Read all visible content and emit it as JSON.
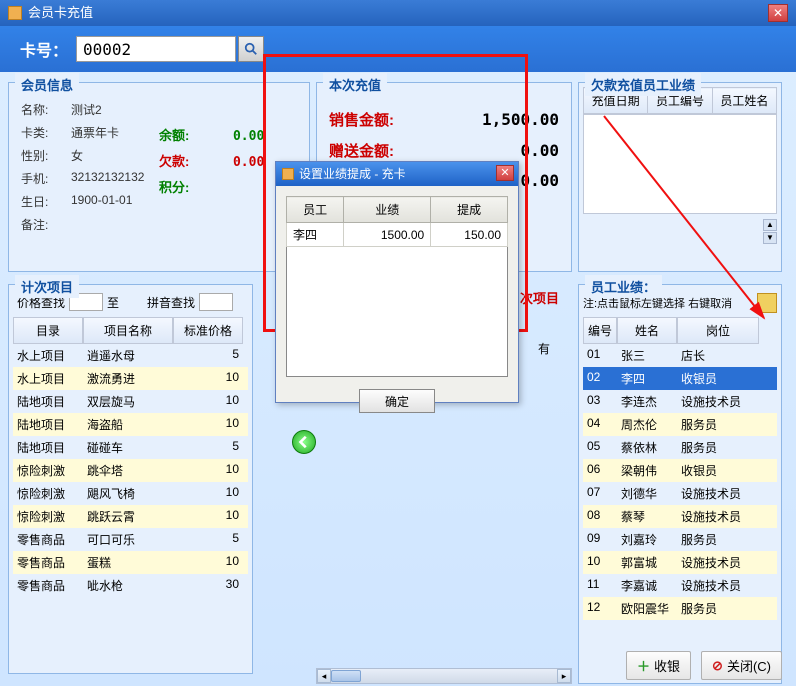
{
  "window": {
    "title": "会员卡充值"
  },
  "topbar": {
    "label": "卡号：",
    "value": "00002"
  },
  "member": {
    "title": "会员信息",
    "fields": {
      "name_k": "名称:",
      "name_v": "测试2",
      "type_k": "卡类:",
      "type_v": "通票年卡",
      "sex_k": "性别:",
      "sex_v": "女",
      "phone_k": "手机:",
      "phone_v": "32132132132",
      "birth_k": "生日:",
      "birth_v": "1900-01-01",
      "note_k": "备注:",
      "note_v": ""
    },
    "extra": {
      "balance_k": "余额:",
      "balance_v": "0.00",
      "arrears_k": "欠款:",
      "arrears_v": "0.00",
      "points_k": "积分:",
      "points_v": ""
    }
  },
  "recharge": {
    "title": "本次充值",
    "sale_k": "销售金额:",
    "sale_v": "1,500.00",
    "bonus_k": "赠送金额:",
    "bonus_v": "0.00",
    "line3_v": "0.00"
  },
  "arrears_panel": {
    "title": "欠款充值员工业绩",
    "cols": {
      "c1": "充值日期",
      "c2": "员工编号",
      "c3": "员工姓名"
    }
  },
  "items": {
    "title": "计次项目",
    "search": {
      "price_k": "价格查找",
      "to": "至",
      "py_k": "拼音查找"
    },
    "cols": {
      "c1": "目录",
      "c2": "项目名称",
      "c3": "标准价格"
    },
    "rows": [
      {
        "c1": "水上项目",
        "c2": "逍遥水母",
        "c3": "5"
      },
      {
        "c1": "水上项目",
        "c2": "激流勇进",
        "c3": "10"
      },
      {
        "c1": "陆地项目",
        "c2": "双层旋马",
        "c3": "10"
      },
      {
        "c1": "陆地项目",
        "c2": "海盗船",
        "c3": "10"
      },
      {
        "c1": "陆地项目",
        "c2": "碰碰车",
        "c3": "5"
      },
      {
        "c1": "惊险刺激",
        "c2": "跳伞塔",
        "c3": "10"
      },
      {
        "c1": "惊险刺激",
        "c2": "飓风飞椅",
        "c3": "10"
      },
      {
        "c1": "惊险刺激",
        "c2": "跳跃云霄",
        "c3": "10"
      },
      {
        "c1": "零售商品",
        "c2": "可口可乐",
        "c3": "5"
      },
      {
        "c1": "零售商品",
        "c2": "蛋糕",
        "c3": "10"
      },
      {
        "c1": "零售商品",
        "c2": "呲水枪",
        "c3": "30"
      }
    ]
  },
  "mid": {
    "has_items": "次项目",
    "has_col": "有"
  },
  "emp": {
    "title": "员工业绩：",
    "note": "注:点击鼠标左键选择 右键取消",
    "cols": {
      "c1": "编号",
      "c2": "姓名",
      "c3": "岗位"
    },
    "rows": [
      {
        "c1": "01",
        "c2": "张三",
        "c3": "店长",
        "sel": false
      },
      {
        "c1": "02",
        "c2": "李四",
        "c3": "收银员",
        "sel": true
      },
      {
        "c1": "03",
        "c2": "李连杰",
        "c3": "设施技术员",
        "sel": false
      },
      {
        "c1": "04",
        "c2": "周杰伦",
        "c3": "服务员",
        "sel": false
      },
      {
        "c1": "05",
        "c2": "蔡依林",
        "c3": "服务员",
        "sel": false
      },
      {
        "c1": "06",
        "c2": "梁朝伟",
        "c3": "收银员",
        "sel": false
      },
      {
        "c1": "07",
        "c2": "刘德华",
        "c3": "设施技术员",
        "sel": false
      },
      {
        "c1": "08",
        "c2": "蔡琴",
        "c3": "设施技术员",
        "sel": false
      },
      {
        "c1": "09",
        "c2": "刘嘉玲",
        "c3": "服务员",
        "sel": false
      },
      {
        "c1": "10",
        "c2": "郭富城",
        "c3": "设施技术员",
        "sel": false
      },
      {
        "c1": "11",
        "c2": "李嘉诚",
        "c3": "设施技术员",
        "sel": false
      },
      {
        "c1": "12",
        "c2": "欧阳震华",
        "c3": "服务员",
        "sel": false
      }
    ]
  },
  "footer": {
    "cashier": "收银",
    "close": "关闭(C)"
  },
  "modal": {
    "title": "设置业绩提成 - 充卡",
    "cols": {
      "c1": "员工",
      "c2": "业绩",
      "c3": "提成"
    },
    "rows": [
      {
        "c1": "李四",
        "c2": "1500.00",
        "c3": "150.00"
      }
    ],
    "ok": "确定"
  }
}
